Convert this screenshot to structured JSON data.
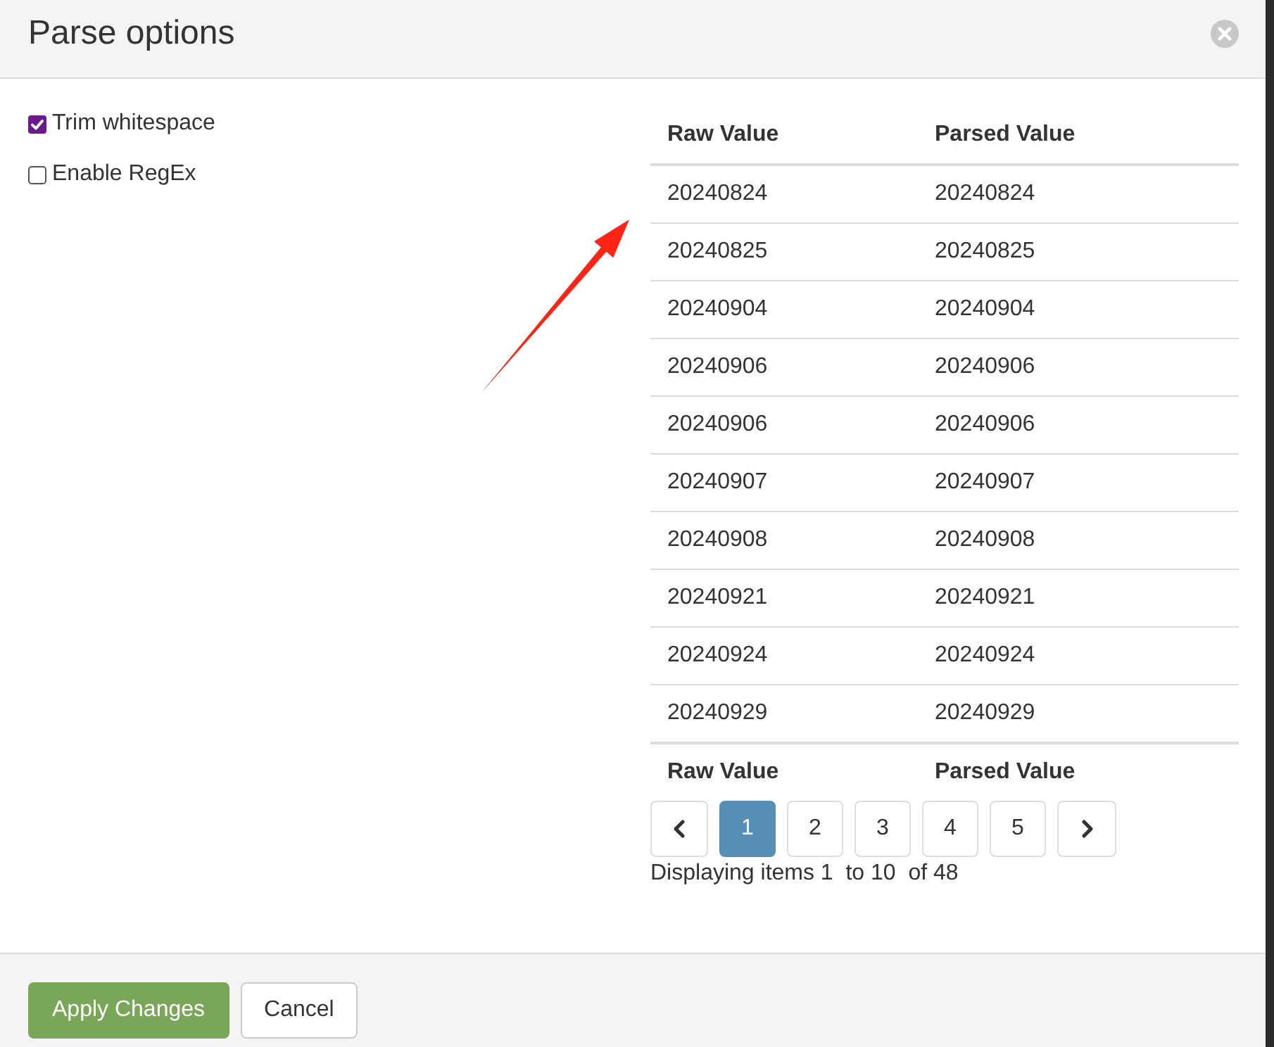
{
  "dialog": {
    "title": "Parse options"
  },
  "options": [
    {
      "label": "Trim whitespace",
      "checked": true
    },
    {
      "label": "Enable RegEx",
      "checked": false
    }
  ],
  "table": {
    "columns": [
      "Raw Value",
      "Parsed Value"
    ],
    "rows": [
      [
        "20240824",
        "20240824"
      ],
      [
        "20240825",
        "20240825"
      ],
      [
        "20240904",
        "20240904"
      ],
      [
        "20240906",
        "20240906"
      ],
      [
        "20240906",
        "20240906"
      ],
      [
        "20240907",
        "20240907"
      ],
      [
        "20240908",
        "20240908"
      ],
      [
        "20240921",
        "20240921"
      ],
      [
        "20240924",
        "20240924"
      ],
      [
        "20240929",
        "20240929"
      ]
    ],
    "footer_columns": [
      "Raw Value",
      "Parsed Value"
    ]
  },
  "pagination": {
    "pages": [
      {
        "label": "1",
        "selected": true
      },
      {
        "label": "2",
        "selected": false
      },
      {
        "label": "3",
        "selected": false
      },
      {
        "label": "4",
        "selected": false
      },
      {
        "label": "5",
        "selected": false
      }
    ],
    "summary": "Displaying items 1  to 10  of 48"
  },
  "buttons": [
    {
      "label": "Apply Changes",
      "kind": "primary"
    },
    {
      "label": "Cancel",
      "kind": "default"
    }
  ]
}
